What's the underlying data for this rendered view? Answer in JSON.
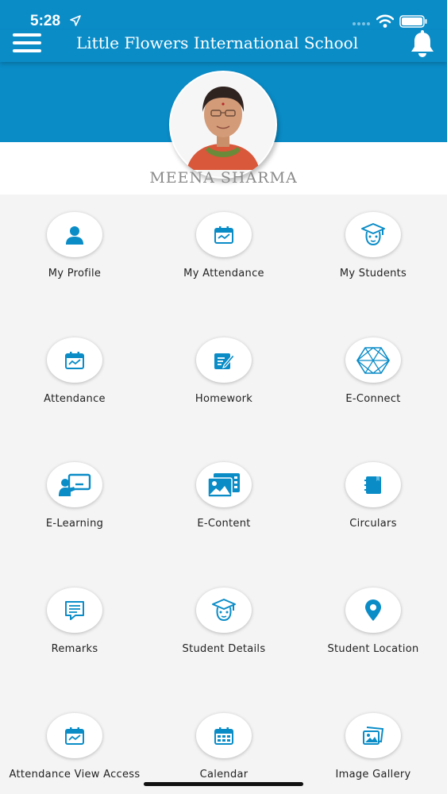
{
  "status_bar": {
    "time": "5:28"
  },
  "header": {
    "title": "Little Flowers International School"
  },
  "profile": {
    "name": "MEENA SHARMA"
  },
  "colors": {
    "brand": "#0a8cc7",
    "icon": "#0a8cc7",
    "name_text": "#8a8a8a"
  },
  "tiles": [
    {
      "label": "My Profile",
      "icon": "person-icon"
    },
    {
      "label": "My Attendance",
      "icon": "attendance-icon"
    },
    {
      "label": "My Students",
      "icon": "student-graduate-icon"
    },
    {
      "label": "Attendance",
      "icon": "attendance-chart-icon"
    },
    {
      "label": "Homework",
      "icon": "homework-icon"
    },
    {
      "label": "E-Connect",
      "icon": "network-icon"
    },
    {
      "label": "E-Learning",
      "icon": "teacher-board-icon"
    },
    {
      "label": "E-Content",
      "icon": "media-gallery-icon"
    },
    {
      "label": "Circulars",
      "icon": "notebook-icon"
    },
    {
      "label": "Remarks",
      "icon": "message-icon"
    },
    {
      "label": "Student Details",
      "icon": "student-graduate-icon"
    },
    {
      "label": "Student Location",
      "icon": "location-pin-icon"
    },
    {
      "label": "Attendance View Access",
      "icon": "attendance-chart-icon"
    },
    {
      "label": "Calendar",
      "icon": "calendar-icon"
    },
    {
      "label": "Image Gallery",
      "icon": "image-gallery-icon"
    }
  ]
}
